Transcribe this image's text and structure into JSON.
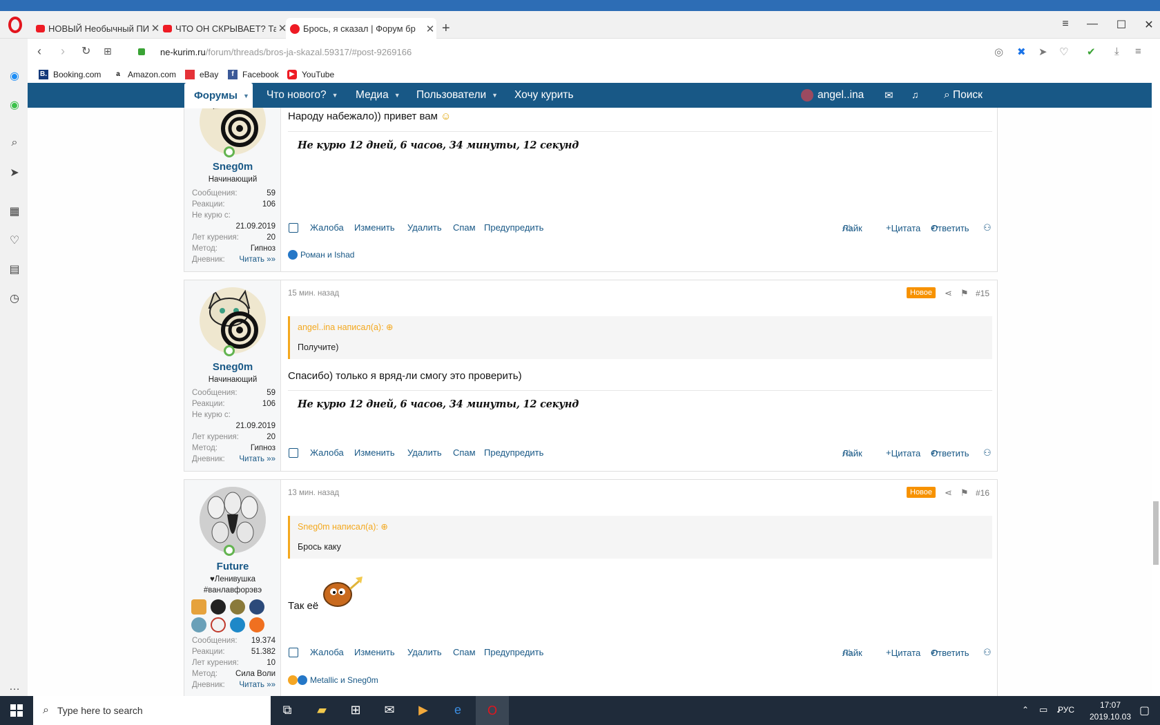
{
  "browser": {
    "tabs": [
      {
        "title": "НОВЫЙ Необычный ПИР",
        "favicon": "youtube-icon"
      },
      {
        "title": "ЧТО ОН СКРЫВАЕТ? Таро",
        "favicon": "youtube-icon"
      },
      {
        "title": "Брось, я сказал | Форум бр",
        "favicon": "stop-sign-icon"
      }
    ],
    "url_host": "ne-kurim.ru",
    "url_path": "/forum/threads/bros-ja-skazal.59317/#post-9269166",
    "bookmarks": [
      "Booking.com",
      "Amazon.com",
      "eBay",
      "Facebook",
      "YouTube"
    ]
  },
  "nav": {
    "forums": "Форумы",
    "whats_new": "Что нового?",
    "media": "Медиа",
    "users": "Пользователи",
    "want_smoke": "Хочу курить",
    "username": "angel..ina",
    "search": "Поиск"
  },
  "stat_labels": {
    "messages": "Сообщения:",
    "reactions": "Реакции:",
    "quit_since": "Не курю с:",
    "years": "Лет курения:",
    "method": "Метод:",
    "diary": "Дневник:"
  },
  "actions": {
    "report": "Жалоба",
    "edit": "Изменить",
    "delete": "Удалить",
    "spam": "Спам",
    "warn": "Предупредить",
    "like": "Лайк",
    "quote": "Цитата",
    "reply": "Ответить"
  },
  "posts": [
    {
      "username": "Sneg0m",
      "user_title": "Начинающий",
      "messages": "59",
      "reactions": "106",
      "quit_since": "21.09.2019",
      "years": "20",
      "method": "Гипноз",
      "diary": "Читать »»",
      "text": "Народу набежало)) привет вам",
      "signature": "Не курю 12 дней, 6 часов, 34 минуты, 12 секунд",
      "reactions_by": "Роман и Ishad"
    },
    {
      "username": "Sneg0m",
      "user_title": "Начинающий",
      "messages": "59",
      "reactions": "106",
      "quit_since": "21.09.2019",
      "years": "20",
      "method": "Гипноз",
      "diary": "Читать »»",
      "time": "15 мин. назад",
      "badge": "Новое",
      "number": "#15",
      "quote_author": "angel..ina написал(а):",
      "quote_text": "Получите)",
      "text": "Спасибо) только я вряд-ли смогу это проверить)",
      "signature": "Не курю 12 дней, 6 часов, 34 минуты, 12 секунд"
    },
    {
      "username": "Future",
      "user_title_1": "♥Ленивушка",
      "user_title_2": "#ванлавфорэвэ",
      "messages": "19.374",
      "reactions": "51.382",
      "years": "10",
      "method": "Сила Воли",
      "diary": "Читать »»",
      "time": "13 мин. назад",
      "badge": "Новое",
      "number": "#16",
      "quote_author": "Sneg0m написал(а):",
      "quote_text": "Брось каку",
      "text": "Так её",
      "reactions_by": "Metallic и Sneg0m"
    }
  ],
  "taskbar": {
    "search_placeholder": "Type here to search",
    "lang": "РУС",
    "time": "17:07",
    "date": "2019.10.03"
  }
}
